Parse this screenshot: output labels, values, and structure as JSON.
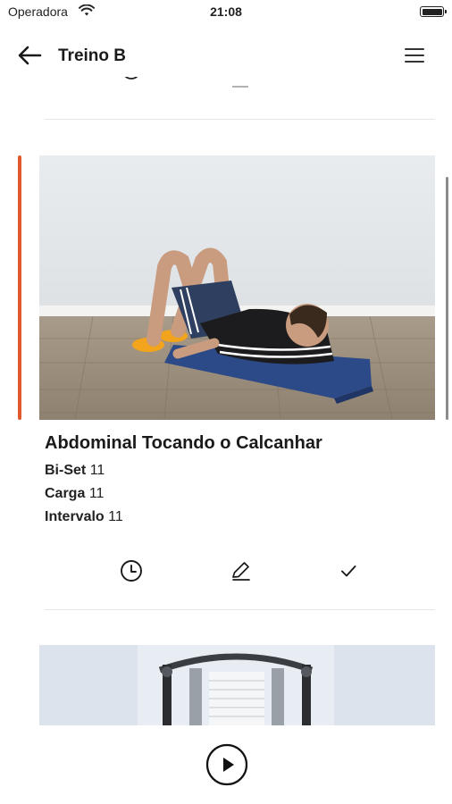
{
  "status": {
    "carrier": "Operadora",
    "time": "21:08"
  },
  "nav": {
    "title": "Treino B",
    "back_icon": "arrow-left-icon",
    "menu_icon": "hamburger-menu-icon"
  },
  "exercise": {
    "title": "Abdominal Tocando o Calcanhar",
    "image_icon": "exercise-photo-image",
    "details": [
      {
        "label": "Bi-Set",
        "value": "11"
      },
      {
        "label": "Carga",
        "value": "11"
      },
      {
        "label": "Intervalo",
        "value": "11"
      }
    ],
    "accent_color": "#e05a2e"
  },
  "actions": {
    "timer_icon": "clock-icon",
    "edit_icon": "pencil-icon",
    "done_icon": "check-icon"
  },
  "footer": {
    "play_icon": "play-icon"
  }
}
